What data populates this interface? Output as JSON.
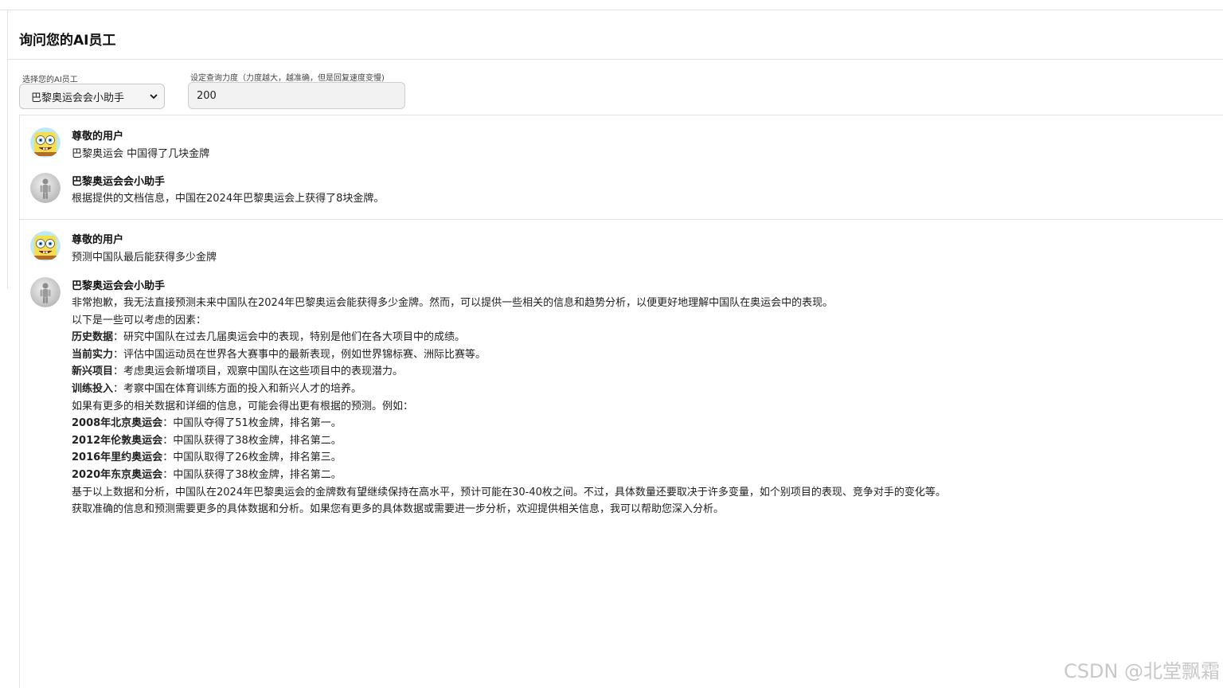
{
  "page": {
    "title": "询问您的AI员工"
  },
  "controls": {
    "employee_label": "选择您的AI员工",
    "employee_selected": "巴黎奥运会会小助手",
    "strength_label": "设定查询力度（力度越大，越准确，但是回复速度变慢)",
    "strength_value": "200"
  },
  "conversation": [
    {
      "user": {
        "name": "尊敬的用户",
        "text": "巴黎奥运会 中国得了几块金牌",
        "avatar_icon": "spongebob-avatar-icon"
      },
      "assistant": {
        "name": "巴黎奥运会会小助手",
        "avatar_icon": "robot-avatar-icon",
        "lines": [
          {
            "label": "",
            "text": "根据提供的文档信息，中国在2024年巴黎奥运会上获得了8块金牌。"
          }
        ]
      }
    },
    {
      "user": {
        "name": "尊敬的用户",
        "text": "预测中国队最后能获得多少金牌",
        "avatar_icon": "spongebob-avatar-icon"
      },
      "assistant": {
        "name": "巴黎奥运会会小助手",
        "avatar_icon": "robot-avatar-icon",
        "lines": [
          {
            "label": "",
            "text": "非常抱歉，我无法直接预测未来中国队在2024年巴黎奥运会能获得多少金牌。然而，可以提供一些相关的信息和趋势分析，以便更好地理解中国队在奥运会中的表现。"
          },
          {
            "label": "",
            "text": "以下是一些可以考虑的因素："
          },
          {
            "label": "历史数据",
            "text": "：研究中国队在过去几届奥运会中的表现，特别是他们在各大项目中的成绩。"
          },
          {
            "label": "当前实力",
            "text": "：评估中国运动员在世界各大赛事中的最新表现，例如世界锦标赛、洲际比赛等。"
          },
          {
            "label": "新兴项目",
            "text": "：考虑奥运会新增项目，观察中国队在这些项目中的表现潜力。"
          },
          {
            "label": "训练投入",
            "text": "：考察中国在体育训练方面的投入和新兴人才的培养。"
          },
          {
            "label": "",
            "text": "如果有更多的相关数据和详细的信息，可能会得出更有根据的预测。例如："
          },
          {
            "label": "2008年北京奥运会",
            "text": "：中国队夺得了51枚金牌，排名第一。"
          },
          {
            "label": "2012年伦敦奥运会",
            "text": "：中国队获得了38枚金牌，排名第二。"
          },
          {
            "label": "2016年里约奥运会",
            "text": "：中国队取得了26枚金牌，排名第三。"
          },
          {
            "label": "2020年东京奥运会",
            "text": "：中国队获得了38枚金牌，排名第二。"
          },
          {
            "label": "",
            "text": "基于以上数据和分析，中国队在2024年巴黎奥运会的金牌数有望继续保持在高水平，预计可能在30-40枚之间。不过，具体数量还要取决于许多变量，如个别项目的表现、竞争对手的变化等。"
          },
          {
            "label": "",
            "text": "获取准确的信息和预测需要更多的具体数据和分析。如果您有更多的具体数据或需要进一步分析，欢迎提供相关信息，我可以帮助您深入分析。"
          }
        ]
      }
    }
  ],
  "watermark": "CSDN @北堂飘霜"
}
